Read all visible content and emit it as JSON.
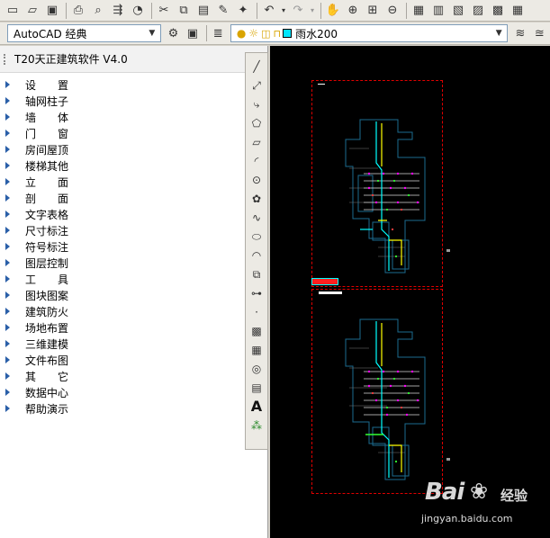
{
  "top_toolbar": {
    "icons": [
      "new-icon",
      "open-icon",
      "save-icon",
      "print-icon",
      "print-preview-icon",
      "publish-icon",
      "3d-publish-icon",
      "cut-icon",
      "copy-icon",
      "paste-icon",
      "match-properties-icon",
      "block-editor-icon",
      "undo-icon",
      "redo-icon",
      "pan-icon",
      "zoom-realtime-icon",
      "zoom-window-icon",
      "zoom-previous-icon",
      "properties-icon",
      "design-center-icon",
      "tool-palettes-icon",
      "sheet-set-icon",
      "markup-icon",
      "calculator-icon"
    ]
  },
  "second_toolbar": {
    "workspace": "AutoCAD 经典",
    "current_layer": "雨水200",
    "layer_color": "#00e5ff"
  },
  "panel": {
    "title": "T20天正建筑软件 V4.0",
    "items": [
      {
        "label": "设　　置"
      },
      {
        "label": "轴网柱子"
      },
      {
        "label": "墙　　体"
      },
      {
        "label": "门　　窗"
      },
      {
        "label": "房间屋顶"
      },
      {
        "label": "楼梯其他"
      },
      {
        "label": "立　　面"
      },
      {
        "label": "剖　　面"
      },
      {
        "label": "文字表格"
      },
      {
        "label": "尺寸标注"
      },
      {
        "label": "符号标注"
      },
      {
        "label": "图层控制"
      },
      {
        "label": "工　　具"
      },
      {
        "label": "图块图案"
      },
      {
        "label": "建筑防火"
      },
      {
        "label": "场地布置"
      },
      {
        "label": "三维建模"
      },
      {
        "label": "文件布图"
      },
      {
        "label": "其　　它"
      },
      {
        "label": "数据中心"
      },
      {
        "label": "帮助演示"
      }
    ]
  },
  "draw_toolbar": {
    "text_tool_label": "A"
  },
  "watermark": {
    "brand": "Bai",
    "brand_cn": "经验",
    "url": "jingyan.baidu.com"
  }
}
